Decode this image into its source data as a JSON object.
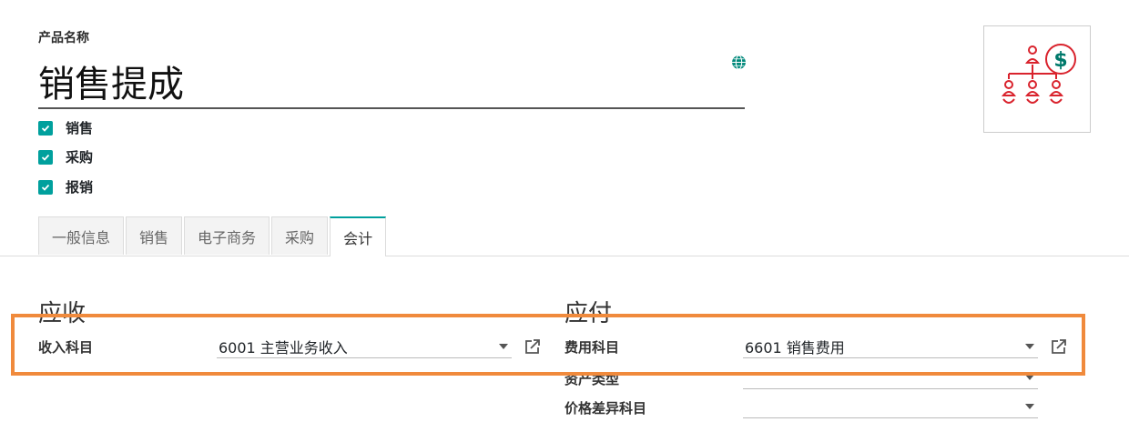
{
  "product": {
    "name_label": "产品名称",
    "name": "销售提成",
    "checkboxes": [
      {
        "label": "销售",
        "checked": true
      },
      {
        "label": "采购",
        "checked": true
      },
      {
        "label": "报销",
        "checked": true
      }
    ]
  },
  "tabs": [
    {
      "label": "一般信息",
      "active": false
    },
    {
      "label": "销售",
      "active": false
    },
    {
      "label": "电子商务",
      "active": false
    },
    {
      "label": "采购",
      "active": false
    },
    {
      "label": "会计",
      "active": true
    }
  ],
  "receivable": {
    "title": "应收",
    "income_account_label": "收入科目",
    "income_account_value": "6001 主营业务收入"
  },
  "payable": {
    "title": "应付",
    "expense_account_label": "费用科目",
    "expense_account_value": "6601 销售费用",
    "asset_type_label": "资产类型",
    "price_diff_label": "价格差异科目"
  },
  "colors": {
    "accent": "#00a09d",
    "highlight": "#f08a3c",
    "image_icon": "#d9232d"
  }
}
